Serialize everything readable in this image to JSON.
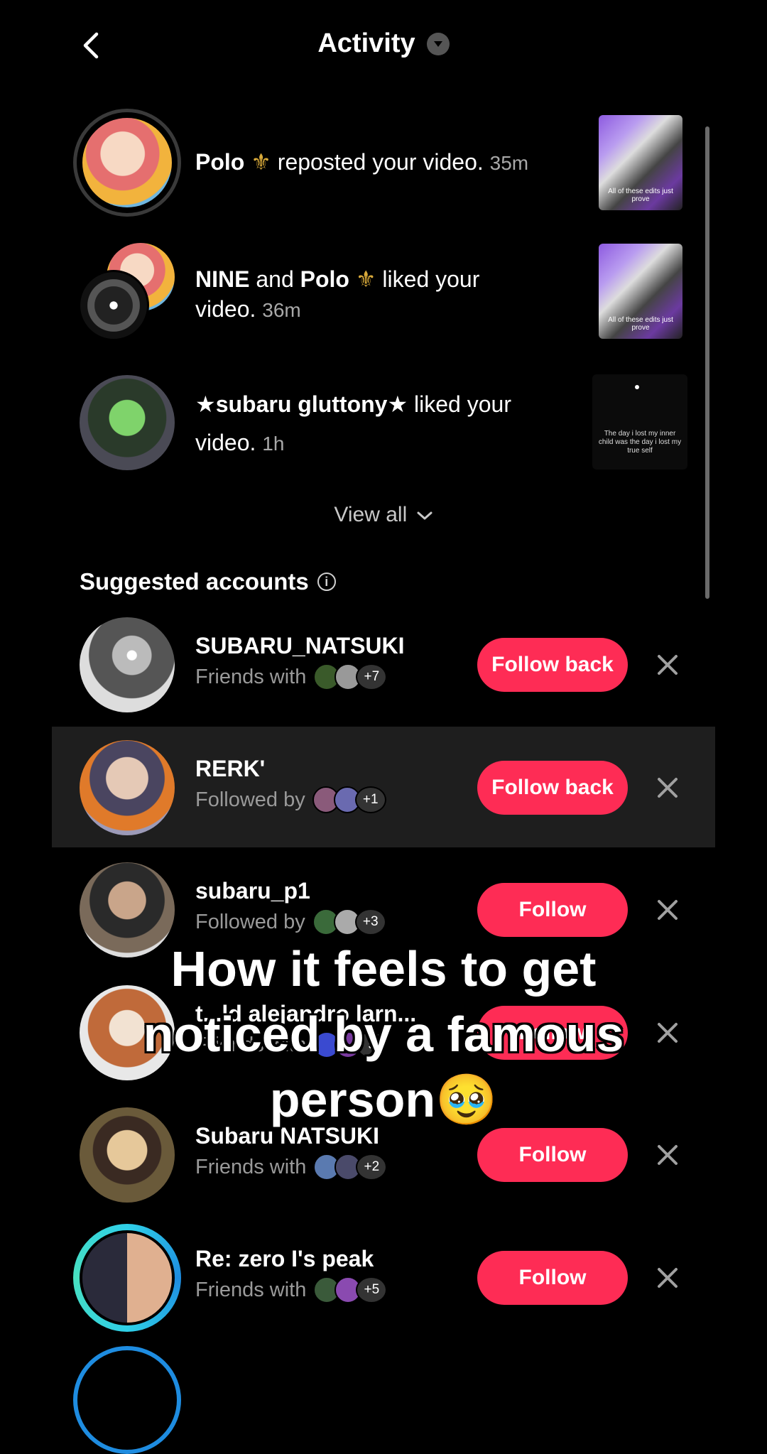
{
  "header": {
    "title": "Activity"
  },
  "activity": [
    {
      "name": "Polo",
      "name2": "",
      "connector": "",
      "action": "reposted your video.",
      "time": "35m",
      "thumb_text": "All of these edits just prove"
    },
    {
      "name": "NINE",
      "name2": "Polo",
      "connector": "and",
      "action": "liked your",
      "action2": "video.",
      "time": "36m",
      "thumb_text": "All of these edits just prove"
    },
    {
      "name": "★subaru gluttony★",
      "name2": "",
      "connector": "",
      "action": "liked your",
      "action2": "video.",
      "time": "1h",
      "thumb_text": "The day i lost my inner child was the day i lost my true self"
    }
  ],
  "view_all": "View all",
  "suggested": {
    "title": "Suggested accounts",
    "accounts": [
      {
        "name": "SUBARU_NATSUKI",
        "relation": "Friends with",
        "extra": "+7",
        "button": "Follow back"
      },
      {
        "name": "RERK'",
        "relation": "Followed by",
        "extra": "+1",
        "button": "Follow back"
      },
      {
        "name": "subaru_p1",
        "relation": "Followed by",
        "extra": "+3",
        "button": "Follow"
      },
      {
        "name": "t...ld alejandro larn...",
        "relation": "Friends with",
        "extra": "9",
        "button": "Follow"
      },
      {
        "name": "Subaru NATSUKI",
        "relation": "Friends with",
        "extra": "+2",
        "button": "Follow"
      },
      {
        "name": "Re: zero I's peak",
        "relation": "Friends with",
        "extra": "+5",
        "button": "Follow"
      }
    ]
  },
  "caption": {
    "line1": "How it feels to get",
    "line2": "noticed by a famous",
    "line3": "person🥹"
  },
  "colors": {
    "accent": "#fe2c55",
    "background": "#000000",
    "secondary_text": "#9a9a9a"
  }
}
